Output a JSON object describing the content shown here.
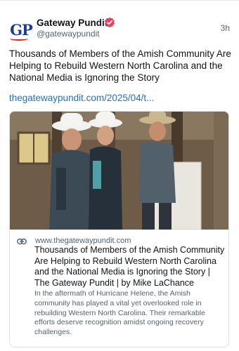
{
  "author": {
    "name": "Gateway Pundit",
    "handle": "@gatewaypundit",
    "avatar_text": "GP",
    "verified": true
  },
  "post": {
    "time": "3h",
    "text": "Thousands of Members of the Amish Community Are Helping to Rebuild Western North Carolina and the National Media is Ignoring the Story",
    "link_text": "thegatewaypundit.com/2025/04/t..."
  },
  "card": {
    "domain": "www.thegatewaypundit.com",
    "title": "Thousands of Members of the Amish Community Are Helping to Rebuild Western North Carolina and the National Media is Ignoring the Story | The Gateway Pundit | by Mike LaChance",
    "description": "In the aftermath of Hurricane Helene, the Amish community has played a vital yet overlooked role in rebuilding Western North Carolina. Their remarkable efforts deserve recognition amidst ongoing recovery challenges."
  },
  "colors": {
    "verified_badge": "#e8425f",
    "link": "#1d6fd8",
    "secondary_text": "#536471",
    "brand_blue": "#1b3f8f",
    "brand_red": "#e2231a"
  },
  "icons": {
    "verified": "verified-badge-icon",
    "link": "link-chain-icon"
  }
}
